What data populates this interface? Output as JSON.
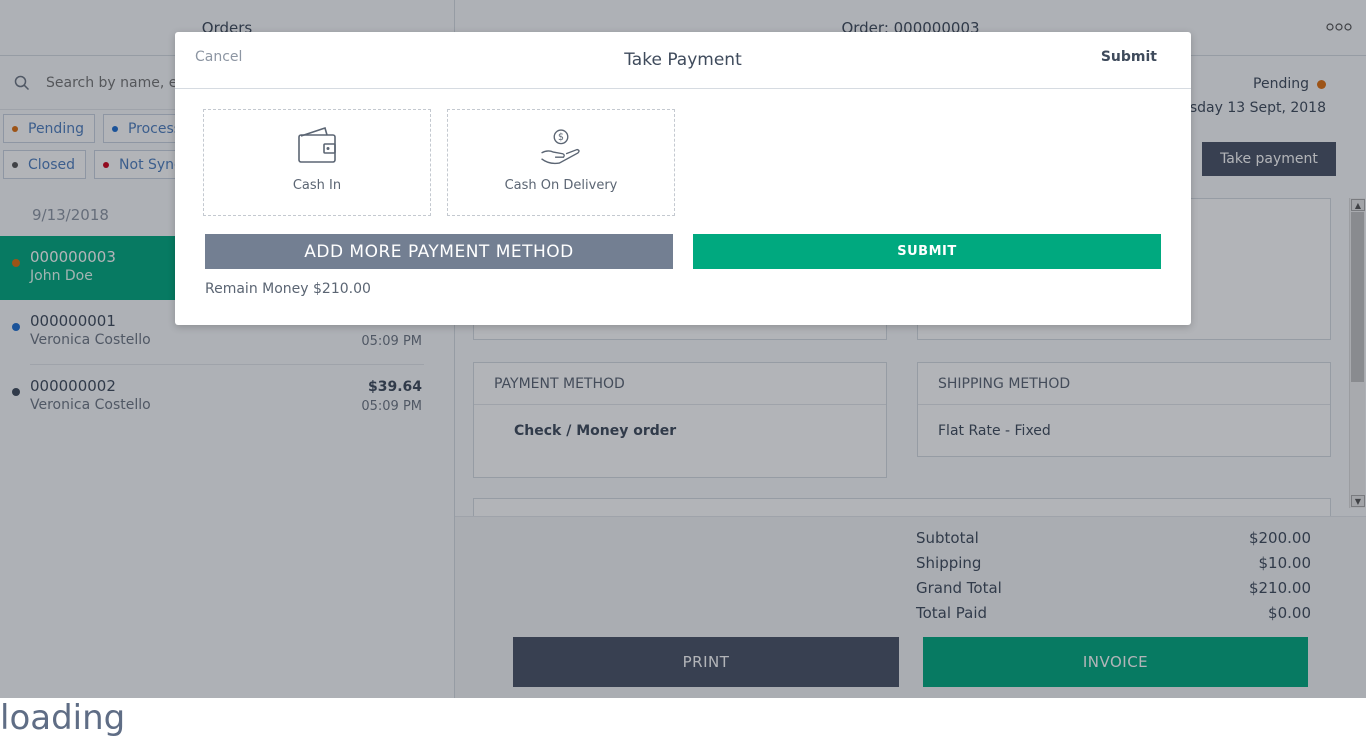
{
  "left_panel": {
    "title": "Orders",
    "search_placeholder": "Search by name, email or order id",
    "filters_row1": [
      {
        "label": "Pending",
        "color": "#e07010"
      },
      {
        "label": "Processing",
        "color": "#1f6fd1"
      }
    ],
    "filters_row2": [
      {
        "label": "Closed",
        "color": "#555555"
      },
      {
        "label": "Not Sync",
        "color": "#d0021b"
      }
    ],
    "date_group": "9/13/2018",
    "orders": [
      {
        "id": "000000003",
        "name": "John Doe",
        "amount": "",
        "time": "",
        "dot": "#e07010"
      },
      {
        "id": "000000001",
        "name": "Veronica Costello",
        "amount": "",
        "time": "05:09 PM",
        "dot": "#1f6fd1"
      },
      {
        "id": "000000002",
        "name": "Veronica Costello",
        "amount": "$39.64",
        "time": "05:09 PM",
        "dot": "#3f4b5c"
      }
    ]
  },
  "right_panel": {
    "title": "Order: 000000003",
    "status": "Pending",
    "date": "Thursday 13 Sept, 2018",
    "take_payment_label": "Take payment",
    "payment_method": {
      "title": "PAYMENT METHOD",
      "value": "Check / Money order"
    },
    "shipping_method": {
      "title": "SHIPPING METHOD",
      "value": "Flat Rate - Fixed"
    },
    "totals": [
      {
        "label": "Subtotal",
        "value": "$200.00"
      },
      {
        "label": "Shipping",
        "value": "$10.00"
      },
      {
        "label": "Grand Total",
        "value": "$210.00"
      },
      {
        "label": "Total Paid",
        "value": "$0.00"
      }
    ],
    "print_label": "PRINT",
    "invoice_label": "INVOICE"
  },
  "modal": {
    "cancel_label": "Cancel",
    "title": "Take Payment",
    "submit_label": "Submit",
    "methods": [
      {
        "label": "Cash In",
        "icon": "wallet-icon"
      },
      {
        "label": "Cash On Delivery",
        "icon": "cash-on-delivery-icon"
      }
    ],
    "add_method_label": "ADD MORE PAYMENT METHOD",
    "submit_button_label": "SUBMIT",
    "remain_text": "Remain Money $210.00"
  },
  "loading_text": "loading",
  "colors": {
    "accent": "#00a97f",
    "dark": "#4a5366",
    "muted_button": "#737f92"
  }
}
